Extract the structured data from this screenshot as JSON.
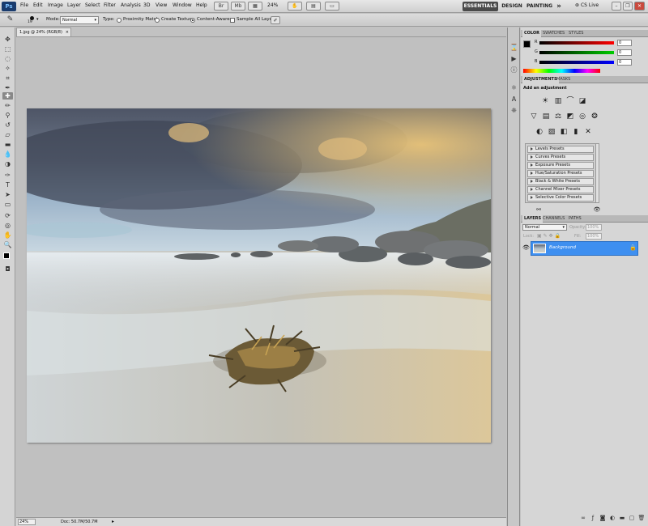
{
  "app": {
    "logo": "Ps",
    "menu": [
      "File",
      "Edit",
      "Image",
      "Layer",
      "Select",
      "Filter",
      "Analysis",
      "3D",
      "View",
      "Window",
      "Help"
    ],
    "zoom": "24%",
    "workspaces": [
      "ESSENTIALS",
      "DESIGN",
      "PAINTING"
    ],
    "more": "»",
    "cs_live": "CS Live"
  },
  "options": {
    "brush_size": "19",
    "mode_label": "Mode:",
    "mode_value": "Normal",
    "type_label": "Type:",
    "proximity": "Proximity Match",
    "texture": "Create Texture",
    "content_aware": "Content-Aware",
    "sample_all": "Sample All Layers"
  },
  "document": {
    "tab_title": "1.jpg @ 24% (RGB/8)",
    "tab_close": "×",
    "status_zoom": "24%",
    "status_doc": "Doc: 50.7M/50.7M"
  },
  "color_panel": {
    "tabs": [
      "COLOR",
      "SWATCHES",
      "STYLES"
    ],
    "r_label": "R",
    "g_label": "G",
    "b_label": "B",
    "r_value": "0",
    "g_value": "0",
    "b_value": "0"
  },
  "adjustments_panel": {
    "tabs": [
      "ADJUSTMENTS",
      "MASKS"
    ],
    "heading": "Add an adjustment",
    "presets": [
      "Levels Presets",
      "Curves Presets",
      "Exposure Presets",
      "Hue/Saturation Presets",
      "Black & White Presets",
      "Channel Mixer Presets",
      "Selective Color Presets"
    ]
  },
  "layers_panel": {
    "tabs": [
      "LAYERS",
      "CHANNELS",
      "PATHS"
    ],
    "blend_mode": "Normal",
    "opacity_label": "Opacity:",
    "opacity_value": "100%",
    "lock_label": "Lock:",
    "fill_label": "Fill:",
    "fill_value": "100%",
    "layer_name": "Background"
  },
  "colors": {
    "accent_blue": "#3e8ff0",
    "workspace_active": "#4a4a4a"
  }
}
